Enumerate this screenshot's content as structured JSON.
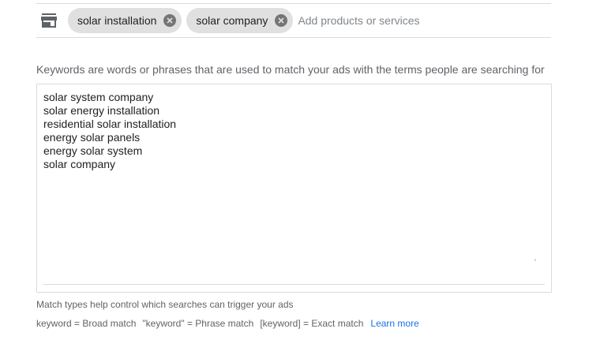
{
  "product_bar": {
    "icon": "store-icon",
    "chips": [
      {
        "label": "solar installation"
      },
      {
        "label": "solar company"
      }
    ],
    "input_placeholder": "Add products or services",
    "input_value": ""
  },
  "keywords": {
    "description": "Keywords are words or phrases that are used to match your ads with the terms people are searching for",
    "items": [
      "solar system company",
      "solar energy installation",
      "residential solar installation",
      "energy solar panels",
      "energy solar system",
      "solar company"
    ]
  },
  "match_types": {
    "help_text": "Match types help control which searches can trigger your ads",
    "broad": "keyword = Broad match",
    "phrase": "\"keyword\" = Phrase match",
    "exact": "[keyword] = Exact match",
    "learn_more": "Learn more"
  },
  "colors": {
    "chip_bg": "#e0e0e0",
    "link": "#1a73e8",
    "border": "#dadce0"
  }
}
